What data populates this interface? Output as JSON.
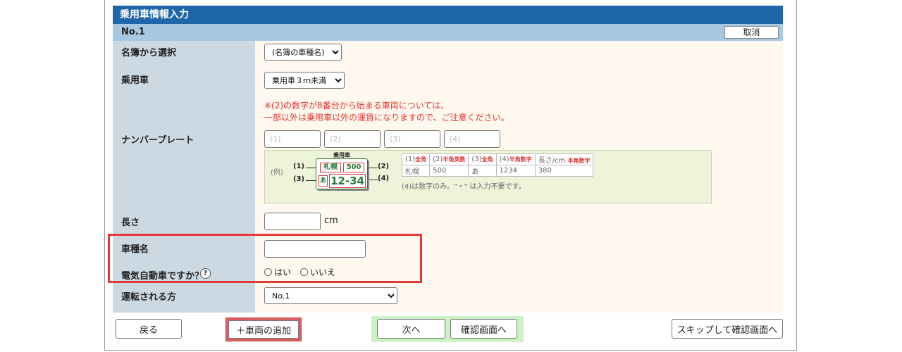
{
  "header": {
    "title": "乗用車情報入力"
  },
  "entry": {
    "number": "No.1",
    "cancel_label": "取消"
  },
  "fields": {
    "list_select": {
      "label": "名簿から選択",
      "value": "(名簿の車種名)"
    },
    "vehicle": {
      "label": "乗用車",
      "value": "乗用車３ｍ未満"
    },
    "notice": {
      "line1": "※(2)の数字が8番台から始まる車両については、",
      "line2": "一部以外は乗用車以外の運賃になりますので、ご注意ください。"
    },
    "plate": {
      "label": "ナンバープレート",
      "placeholders": [
        "(1)",
        "(2)",
        "(3)",
        "(4)"
      ]
    },
    "length": {
      "label": "長さ",
      "unit": "cm",
      "value": ""
    },
    "model": {
      "label": "車種名",
      "value": ""
    },
    "ev": {
      "label": "電気自動車ですか？",
      "help": "?",
      "options": [
        "はい",
        "いいえ"
      ]
    },
    "driver": {
      "label": "運転される方",
      "value": "No.1"
    }
  },
  "example": {
    "label": "(例)",
    "title": "乗用車",
    "plate": {
      "region": "札幌",
      "class": "500",
      "kana": "あ",
      "number": "12-34"
    },
    "callouts": [
      "(1)",
      "(2)",
      "(3)",
      "(4)"
    ],
    "table": {
      "headers": [
        {
          "text": "(1)",
          "tag": "全角"
        },
        {
          "text": "(2)",
          "tag": "半角英数"
        },
        {
          "text": "(3)",
          "tag": "全角"
        },
        {
          "text": "(4)",
          "tag": "半角数字"
        },
        {
          "text": "長さ/cm",
          "tag": "半角数字"
        }
      ],
      "values": [
        "札幌",
        "500",
        "あ",
        "1234",
        "380"
      ]
    },
    "note": "(4)は数字のみ。\"・\" は入力不要です。"
  },
  "footer": {
    "back": "戻る",
    "add_vehicle": "＋車両の追加",
    "next": "次へ",
    "confirm": "確認画面へ",
    "skip": "スキップして確認画面へ"
  },
  "colors": {
    "title_bar": "#1f66a8",
    "sub_bar": "#a7c8e2",
    "label_column": "#cdd9e2",
    "value_column": "#fff8ee",
    "notice_text": "#e3342f",
    "highlight": "#e53935",
    "add_button_bg": "#d9605f",
    "nav_group_bg": "#cdf1c5"
  }
}
